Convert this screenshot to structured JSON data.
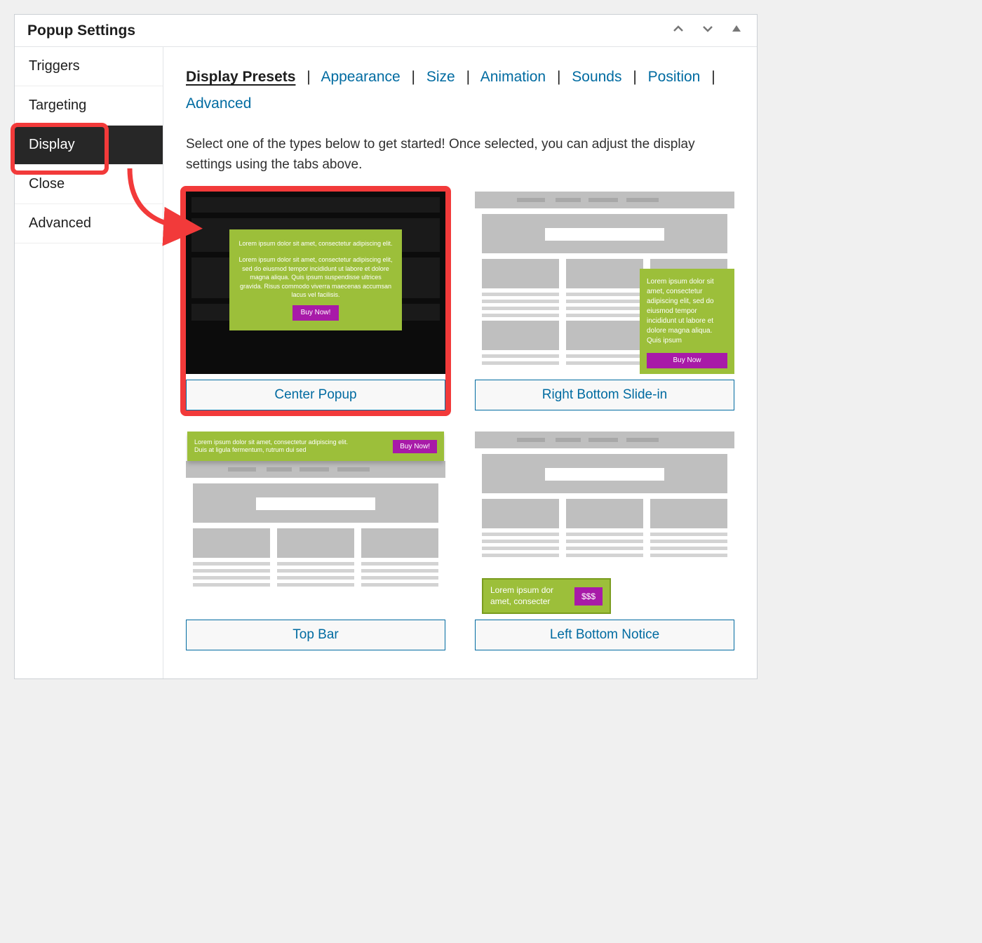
{
  "panel": {
    "title": "Popup Settings"
  },
  "sidebar": {
    "items": [
      {
        "label": "Triggers"
      },
      {
        "label": "Targeting"
      },
      {
        "label": "Display",
        "active": true,
        "highlighted": true
      },
      {
        "label": "Close"
      },
      {
        "label": "Advanced"
      }
    ]
  },
  "subtabs": [
    {
      "label": "Display Presets",
      "active": true
    },
    {
      "label": "Appearance"
    },
    {
      "label": "Size"
    },
    {
      "label": "Animation"
    },
    {
      "label": "Sounds"
    },
    {
      "label": "Position"
    },
    {
      "label": "Advanced"
    }
  ],
  "intro": "Select one of the types below to get started! Once selected, you can adjust the display settings using the tabs above.",
  "presets": {
    "center_popup": {
      "label": "Center Popup",
      "headline": "Lorem ipsum dolor sit amet, consectetur adipiscing elit.",
      "body": "Lorem ipsum dolor sit amet, consectetur adipiscing elit, sed do eiusmod tempor incididunt ut labore et dolore magna aliqua. Quis ipsum suspendisse ultrices gravida. Risus commodo viverra maecenas accumsan lacus vel facilisis.",
      "cta": "Buy Now!"
    },
    "right_bottom_slidein": {
      "label": "Right Bottom Slide-in",
      "body": "Lorem ipsum dolor sit amet, consectetur adipiscing elit, sed do eiusmod tempor incididunt ut labore et dolore magna aliqua. Quis ipsum",
      "cta": "Buy Now"
    },
    "top_bar": {
      "label": "Top Bar",
      "line1": "Lorem ipsum dolor sit amet, consectetur adipiscing elit.",
      "line2": "Duis at ligula fermentum, rutrum dui sed",
      "cta": "Buy Now!"
    },
    "left_bottom_notice": {
      "label": "Left Bottom Notice",
      "body": "Lorem ipsum dor amet, consecter",
      "cta": "$$$"
    }
  }
}
